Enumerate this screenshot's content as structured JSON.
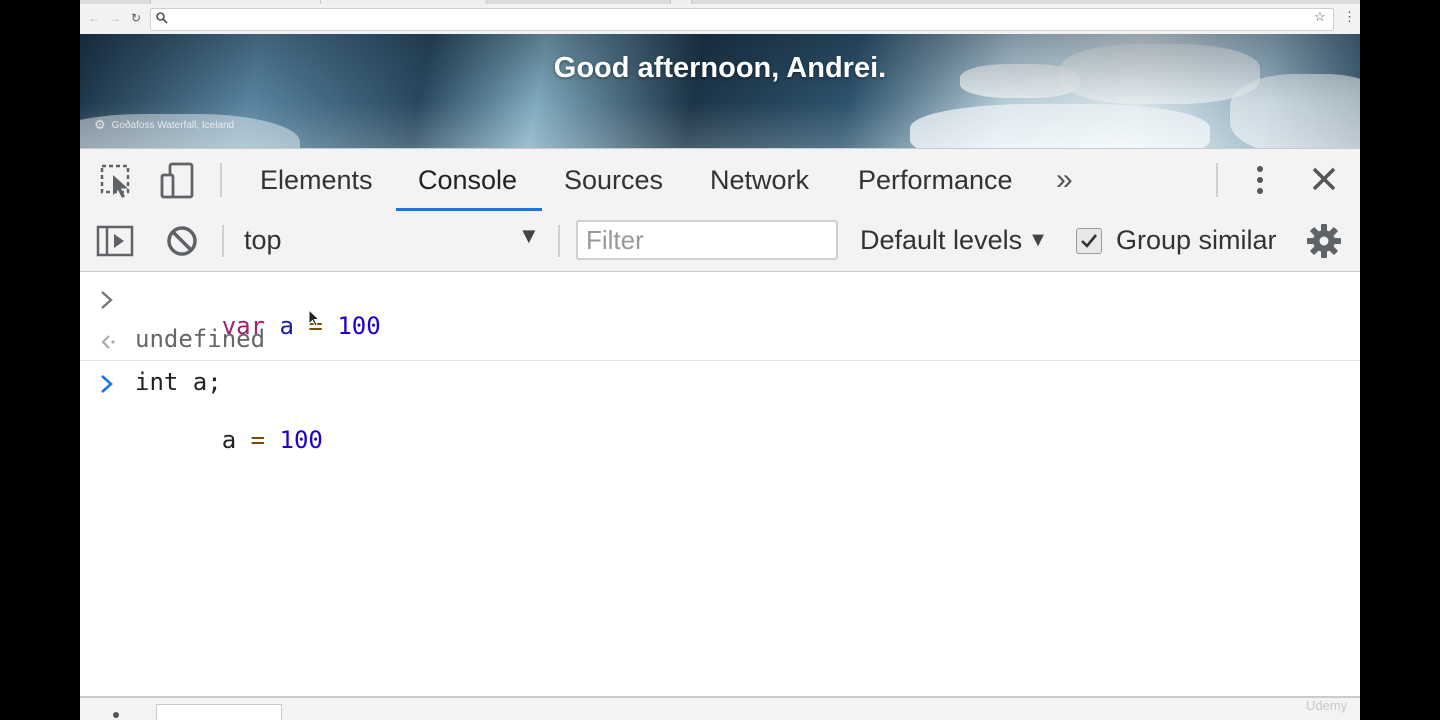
{
  "browser": {
    "address_value": "",
    "nav": {
      "back": "←",
      "forward": "→",
      "reload": "↻"
    },
    "star": "☆",
    "menu": "⋮"
  },
  "banner": {
    "greeting": "Good afternoon, Andrei.",
    "photo_credit": "Goðafoss Waterfall, Iceland"
  },
  "devtools": {
    "tabs": [
      {
        "label": "Elements",
        "active": false
      },
      {
        "label": "Console",
        "active": true
      },
      {
        "label": "Sources",
        "active": false
      },
      {
        "label": "Network",
        "active": false
      },
      {
        "label": "Performance",
        "active": false
      }
    ],
    "more_tabs": "»",
    "accent_color": "#1a73e8"
  },
  "console_toolbar": {
    "context": "top",
    "filter_placeholder": "Filter",
    "levels": "Default levels",
    "group_similar": "Group similar",
    "group_similar_checked": true
  },
  "console": {
    "entry1": {
      "kw": "var",
      "name": "a",
      "op": "=",
      "value": "100"
    },
    "entry1_result": "undefined",
    "entry2_line1": "int a;",
    "entry2_line2": {
      "name": "a",
      "op": "=",
      "value": "100"
    }
  },
  "watermark": "Udemy"
}
